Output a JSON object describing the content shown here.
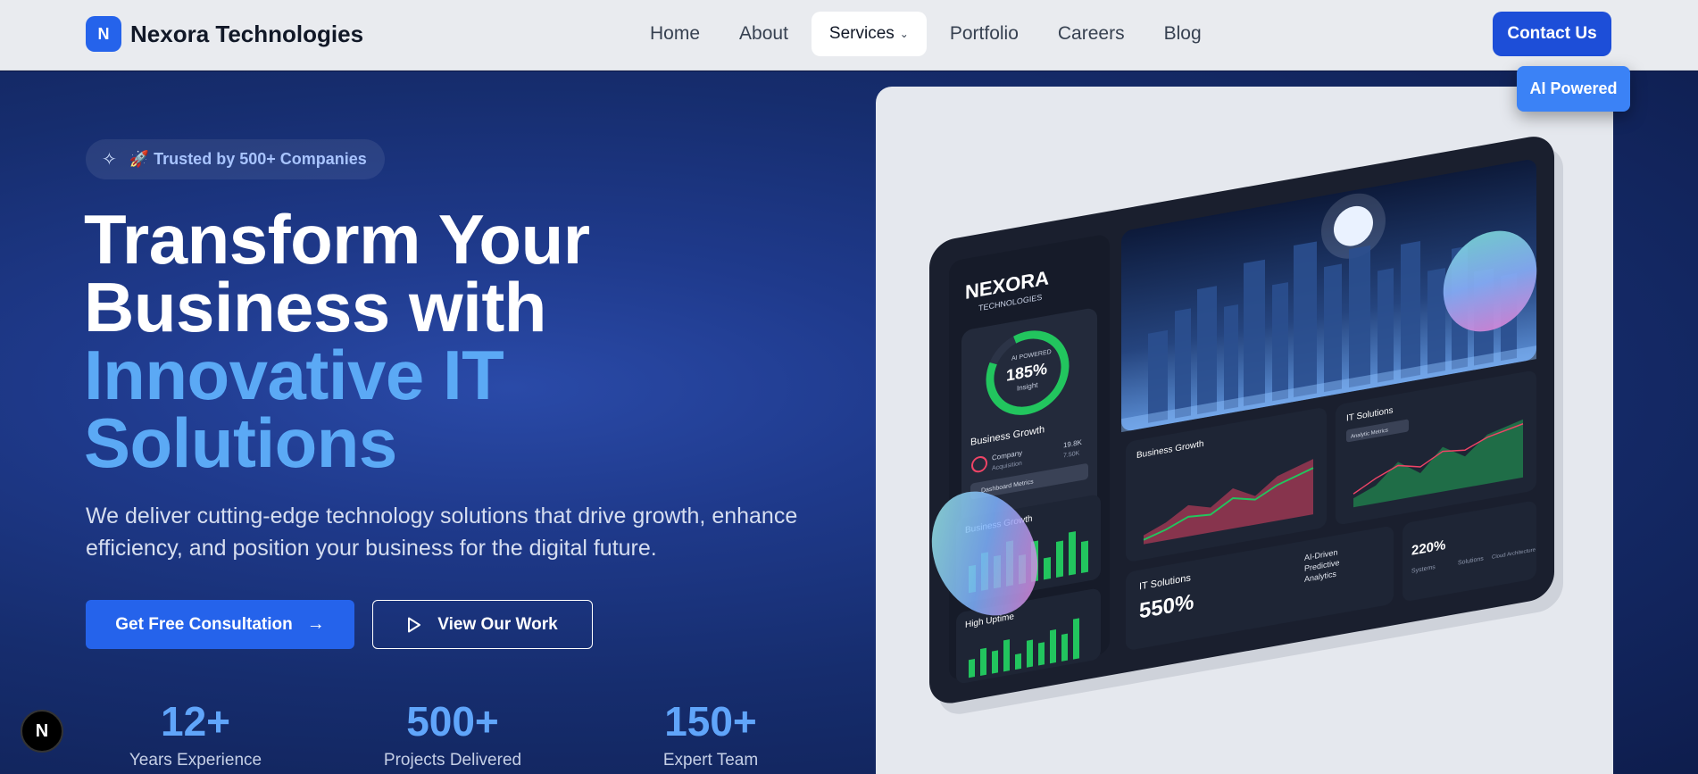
{
  "brand": {
    "initial": "N",
    "name": "Nexora Technologies"
  },
  "nav": {
    "items": [
      {
        "label": "Home"
      },
      {
        "label": "About"
      },
      {
        "label": "Services"
      },
      {
        "label": "Portfolio"
      },
      {
        "label": "Careers"
      },
      {
        "label": "Blog"
      }
    ],
    "active": "Services",
    "contact_label": "Contact Us"
  },
  "hero": {
    "badge": "🚀 Trusted by 500+ Companies",
    "headline_white_1": "Transform Your",
    "headline_white_2": "Business with",
    "headline_blue_1": "Innovative IT",
    "headline_blue_2": "Solutions",
    "subtitle": "We deliver cutting-edge technology solutions that drive growth, enhance efficiency, and position your business for the digital future.",
    "primary_cta": "Get Free Consultation",
    "secondary_cta": "View Our Work",
    "stats": [
      {
        "value": "12+",
        "label": "Years Experience"
      },
      {
        "value": "500+",
        "label": "Projects Delivered"
      },
      {
        "value": "150+",
        "label": "Expert Team"
      }
    ]
  },
  "image_card": {
    "badge": "AI Powered",
    "mockup": {
      "logo": "NEXORA",
      "logo_sub": "TECHNOLOGIES",
      "ring_top": "AI POWERED",
      "ring_value": "185%",
      "ring_bottom": "Insight",
      "bg_title": "Business Growth",
      "bg_line1": "Company",
      "bg_line2": "Acquisition",
      "bg_val1": "19.8K",
      "bg_val2": "7.50K",
      "bg_btn": "Dashboard Metrics",
      "bar1_title": "Business Growth",
      "bar2_title": "High Uptime",
      "chart1_title": "Business Growth",
      "chart2_title": "IT Solutions",
      "chart2_select": "Analytic Metrics",
      "bottom_title": "IT Solutions",
      "bottom_value": "550%",
      "bottom_right": [
        "AI-Driven",
        "Predictive",
        "Analytics"
      ],
      "mini_value": "220%",
      "mini_labels": [
        "Systems",
        "Solutions",
        "Cloud Architecture"
      ]
    }
  },
  "colors": {
    "accent": "#2563eb",
    "highlight": "#5ba9f5",
    "stat": "#60a5fa",
    "nav_bg": "#e9ebef",
    "hero_bg": "#1a3380"
  }
}
